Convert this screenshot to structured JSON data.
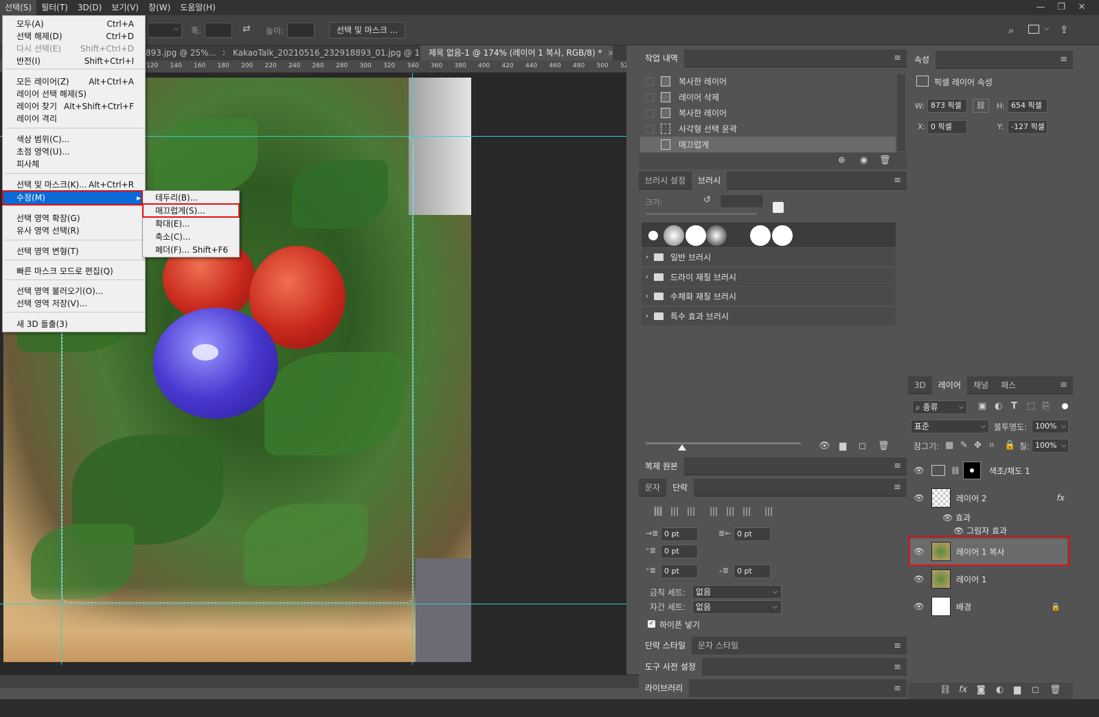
{
  "menubar": {
    "items": [
      "선택(S)",
      "필터(T)",
      "3D(D)",
      "보기(V)",
      "창(W)",
      "도움말(H)"
    ],
    "window_controls": [
      "—",
      "❐",
      "✕"
    ]
  },
  "options": {
    "width_label": "폭:",
    "height_label": "높이:",
    "select_mask_button": "선택 및 마스크 ..."
  },
  "doc_tabs": [
    {
      "label": "893.jpg @ 25%...",
      "close": "×"
    },
    {
      "label": "KakaoTalk_20210516_232918893_01.jpg @ 1...",
      "close": "×"
    },
    {
      "label": "제목 없음-1 @ 174% (레이어 1 복사, RGB/8) *",
      "close": "×"
    }
  ],
  "ruler_ticks": [
    "120",
    "140",
    "160",
    "180",
    "200",
    "220",
    "240",
    "260",
    "280",
    "300",
    "320",
    "340",
    "360",
    "380",
    "400",
    "420",
    "440",
    "460",
    "480",
    "500",
    "520"
  ],
  "select_menu": [
    {
      "label": "모두(A)",
      "shortcut": "Ctrl+A",
      "disabled": false
    },
    {
      "label": "선택 해제(D)",
      "shortcut": "Ctrl+D",
      "disabled": false
    },
    {
      "label": "다시 선택(E)",
      "shortcut": "Shift+Ctrl+D",
      "disabled": true
    },
    {
      "label": "반전(I)",
      "shortcut": "Shift+Ctrl+I",
      "disabled": false
    },
    {
      "label": "모든 레이어(Z)",
      "shortcut": "Alt+Ctrl+A",
      "disabled": false
    },
    {
      "label": "레이어 선택 해제(S)",
      "shortcut": "",
      "disabled": false
    },
    {
      "label": "레이어 찾기",
      "shortcut": "Alt+Shift+Ctrl+F",
      "disabled": false
    },
    {
      "label": "레이어 격리",
      "shortcut": "",
      "disabled": false
    },
    {
      "label": "색상 범위(C)...",
      "shortcut": "",
      "disabled": false
    },
    {
      "label": "초점 영역(U)...",
      "shortcut": "",
      "disabled": false
    },
    {
      "label": "피사체",
      "shortcut": "",
      "disabled": false
    },
    {
      "label": "선택 및 마스크(K)...",
      "shortcut": "Alt+Ctrl+R",
      "disabled": false
    },
    {
      "label": "수정(M)",
      "shortcut": "",
      "disabled": false
    },
    {
      "label": "선택 영역 확장(G)",
      "shortcut": "",
      "disabled": false
    },
    {
      "label": "유사 영역 선택(R)",
      "shortcut": "",
      "disabled": false
    },
    {
      "label": "선택 영역 변형(T)",
      "shortcut": "",
      "disabled": false
    },
    {
      "label": "빠른 마스크 모드로 편집(Q)",
      "shortcut": "",
      "disabled": false
    },
    {
      "label": "선택 영역 불러오기(O)...",
      "shortcut": "",
      "disabled": false
    },
    {
      "label": "선택 영역 저장(V)...",
      "shortcut": "",
      "disabled": false
    },
    {
      "label": "새 3D 돌출(3)",
      "shortcut": "",
      "disabled": false
    }
  ],
  "modify_submenu": [
    {
      "label": "테두리(B)...",
      "shortcut": ""
    },
    {
      "label": "매끄럽게(S)...",
      "shortcut": ""
    },
    {
      "label": "확대(E)...",
      "shortcut": ""
    },
    {
      "label": "축소(C)...",
      "shortcut": ""
    },
    {
      "label": "페더(F)...",
      "shortcut": "Shift+F6"
    }
  ],
  "history": {
    "tab": "작업 내역",
    "items": [
      "복사한 레이어",
      "레이어 삭제",
      "복사한 레이어",
      "사각형 선택 윤곽",
      "매끄럽게"
    ]
  },
  "brush": {
    "tabs": [
      "브러시 설정",
      "브러시"
    ],
    "size_label": "크기:",
    "folders": [
      "일반 브러시",
      "드라이 재질 브러시",
      "수채화 재질 브러시",
      "특수 효과 브러시"
    ]
  },
  "clone_source": {
    "tab": "복제 원본"
  },
  "paragraph": {
    "tabs": [
      "문자",
      "단락"
    ],
    "fields": [
      "0 pt",
      "0 pt",
      "0 pt",
      "0 pt",
      "0 pt"
    ],
    "kinsoku_label": "금칙 세트:",
    "kinsoku_value": "없음",
    "mojikumi_label": "자간 세트:",
    "mojikumi_value": "없음",
    "hyphenate_label": "하이픈 넣기"
  },
  "bottom_panels": [
    "단락 스타일",
    "문자 스타일",
    "도구 사전 설정",
    "라이브러리"
  ],
  "properties": {
    "tab": "속성",
    "title": "픽셀 레이어 속성",
    "w_label": "W:",
    "w_value": "873 픽셀",
    "h_label": "H:",
    "h_value": "654 픽셀",
    "x_label": "X:",
    "x_value": "0 픽셀",
    "y_label": "Y:",
    "y_value": "-127 픽셀"
  },
  "layers": {
    "tabs": [
      "3D",
      "레이어",
      "채널",
      "패스"
    ],
    "filter_kind": "종류",
    "blend_mode": "표준",
    "opacity_label": "불투명도:",
    "opacity_value": "100%",
    "lock_label": "잠그기:",
    "fill_label": "칠:",
    "fill_value": "100%",
    "items": [
      {
        "name": "색조/채도 1"
      },
      {
        "name": "레이어 2",
        "fx": "fx"
      },
      {
        "name": "효과"
      },
      {
        "name": "그림자 효과"
      },
      {
        "name": "레이어 1 복사"
      },
      {
        "name": "레이어 1"
      },
      {
        "name": "배경"
      }
    ]
  },
  "colors": {
    "highlight": "#0a6ad7",
    "annotation_red": "#e01010",
    "guide": "#2fd2d2"
  }
}
